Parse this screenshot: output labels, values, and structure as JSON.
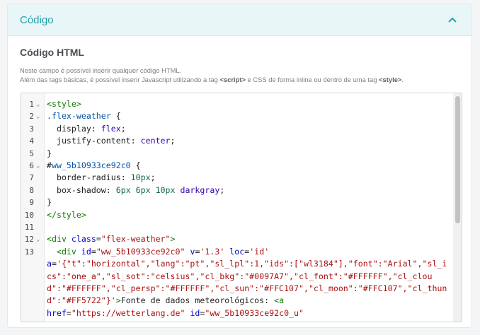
{
  "panel": {
    "title": "Código",
    "accent_color": "#1fa3ad",
    "header_bg": "#e8f6f7"
  },
  "section": {
    "title": "Código HTML",
    "help_line1": "Neste campo é possível inserir qualquer código HTML.",
    "help_line2_a": "Além das tags básicas, é possível inserir Javascript utilizando a tag ",
    "help_line2_tag1": "<script>",
    "help_line2_b": " e CSS de forma inline ou dentro de uma tag ",
    "help_line2_tag2": "<style>",
    "help_line2_c": "."
  },
  "editor": {
    "lines": [
      {
        "n": "1",
        "fold": true
      },
      {
        "n": "2",
        "fold": true
      },
      {
        "n": "3",
        "fold": false
      },
      {
        "n": "4",
        "fold": false
      },
      {
        "n": "5",
        "fold": false
      },
      {
        "n": "6",
        "fold": true
      },
      {
        "n": "7",
        "fold": false
      },
      {
        "n": "8",
        "fold": false
      },
      {
        "n": "9",
        "fold": false
      },
      {
        "n": "10",
        "fold": false
      },
      {
        "n": "11",
        "fold": false
      },
      {
        "n": "12",
        "fold": true
      },
      {
        "n": "13",
        "fold": false
      }
    ],
    "code": [
      [
        [
          "tag",
          "<style>"
        ]
      ],
      [
        [
          "sel",
          ".flex-weather"
        ],
        [
          "prop",
          " {"
        ]
      ],
      [
        [
          "prop",
          "  display: "
        ],
        [
          "kw",
          "flex"
        ],
        [
          "prop",
          ";"
        ]
      ],
      [
        [
          "prop",
          "  justify-content: "
        ],
        [
          "kw",
          "center"
        ],
        [
          "prop",
          ";"
        ]
      ],
      [
        [
          "prop",
          "}"
        ]
      ],
      [
        [
          "prop",
          "#"
        ],
        [
          "sel",
          "ww_5b10933ce92c0"
        ],
        [
          "prop",
          " {"
        ]
      ],
      [
        [
          "prop",
          "  border-radius: "
        ],
        [
          "num",
          "10px"
        ],
        [
          "prop",
          ";"
        ]
      ],
      [
        [
          "prop",
          "  box-shadow: "
        ],
        [
          "num",
          "6px 6px 10px"
        ],
        [
          "prop",
          " "
        ],
        [
          "kw",
          "darkgray"
        ],
        [
          "prop",
          ";"
        ]
      ],
      [
        [
          "prop",
          "}"
        ]
      ],
      [
        [
          "tag",
          "</style>"
        ]
      ],
      [],
      [
        [
          "tag",
          "<div"
        ],
        [
          "prop",
          " "
        ],
        [
          "attr",
          "class"
        ],
        [
          "prop",
          "="
        ],
        [
          "str",
          "\"flex-weather\""
        ],
        [
          "tag",
          ">"
        ]
      ],
      [
        [
          "prop",
          "  "
        ],
        [
          "tag",
          "<div"
        ],
        [
          "prop",
          " "
        ],
        [
          "attr",
          "id"
        ],
        [
          "prop",
          "="
        ],
        [
          "str",
          "\"ww_5b10933ce92c0\""
        ],
        [
          "prop",
          " "
        ],
        [
          "attr",
          "v"
        ],
        [
          "prop",
          "="
        ],
        [
          "str",
          "'1.3'"
        ],
        [
          "prop",
          " "
        ],
        [
          "attr",
          "loc"
        ],
        [
          "prop",
          "="
        ],
        [
          "str",
          "'id'"
        ],
        [
          "prop",
          "\n"
        ],
        [
          "attr",
          "a"
        ],
        [
          "prop",
          "="
        ],
        [
          "str",
          "'{\"t\":\"horizontal\",\"lang\":\"pt\",\"sl_lpl\":1,\"ids\":[\"wl3184\"],\"font\":\"Arial\",\"sl_ics\":\"one_a\",\"sl_sot\":\"celsius\",\"cl_bkg\":\"#0097A7\",\"cl_font\":\"#FFFFFF\",\"cl_cloud\":\"#FFFFFF\",\"cl_persp\":\"#FFFFFF\",\"cl_sun\":\"#FFC107\",\"cl_moon\":\"#FFC107\",\"cl_thund\":\"#FF5722\"}'"
        ],
        [
          "tag",
          ">"
        ],
        [
          "prop",
          "Fonte de dados meteorológicos: "
        ],
        [
          "tag",
          "<a"
        ],
        [
          "prop",
          "\n"
        ],
        [
          "attr",
          "href"
        ],
        [
          "prop",
          "="
        ],
        [
          "str",
          "\"https://wetterlang.de\""
        ],
        [
          "prop",
          " "
        ],
        [
          "attr",
          "id"
        ],
        [
          "prop",
          "="
        ],
        [
          "str",
          "\"ww_5b10933ce92c0_u\""
        ]
      ]
    ]
  }
}
